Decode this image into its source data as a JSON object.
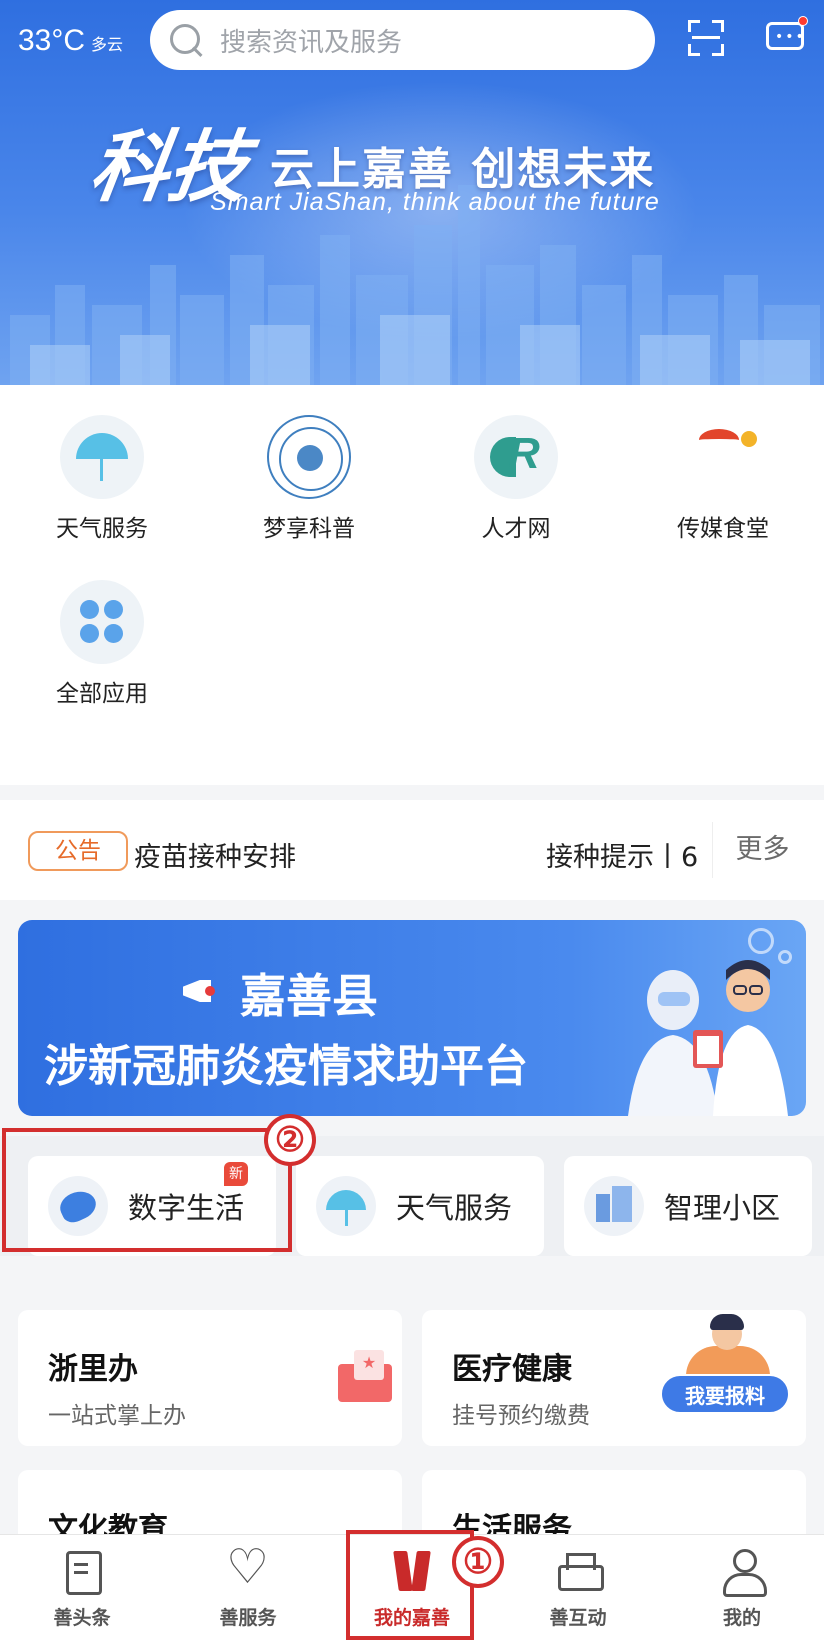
{
  "header": {
    "temperature": "33°C",
    "weather_condition": "多云",
    "search_placeholder": "搜索资讯及服务",
    "scan_icon": "scan-icon",
    "message_icon": "message-icon"
  },
  "banner": {
    "slogan_big": "科技",
    "slogan_main": "云上嘉善  创想未来",
    "slogan_en": "Smart JiaShan, think about the future"
  },
  "apps": [
    {
      "label": "天气服务",
      "icon": "umbrella-icon"
    },
    {
      "label": "梦享科普",
      "icon": "seal-icon"
    },
    {
      "label": "人才网",
      "icon": "talent-logo-icon"
    },
    {
      "label": "传媒食堂",
      "icon": "media-logo-icon"
    },
    {
      "label": "全部应用",
      "icon": "grid-icon"
    }
  ],
  "notice": {
    "tag": "公告",
    "text_left": "疫苗接种安排",
    "text_right": "接种提示丨6",
    "more": "更多"
  },
  "covid_banner": {
    "title": "嘉善县",
    "subtitle": "涉新冠肺炎疫情求助平台"
  },
  "quick_cards": [
    {
      "label": "数字生活",
      "badge": "新",
      "icon": "digital-life-icon"
    },
    {
      "label": "天气服务",
      "icon": "umbrella-icon"
    },
    {
      "label": "智理小区",
      "icon": "community-icon"
    }
  ],
  "annotations": {
    "step1": "①",
    "step2": "②"
  },
  "services": [
    {
      "title": "浙里办",
      "subtitle": "一站式掌上办"
    },
    {
      "title": "医疗健康",
      "subtitle": "挂号预约缴费"
    },
    {
      "title": "文化教育",
      "subtitle": ""
    },
    {
      "title": "生活服务",
      "subtitle": ""
    }
  ],
  "report_button": "我要报料",
  "tabs": [
    {
      "label": "善头条",
      "icon": "news-icon"
    },
    {
      "label": "善服务",
      "icon": "heart-icon"
    },
    {
      "label": "我的嘉善",
      "icon": "jiashan-logo-icon",
      "active": true
    },
    {
      "label": "善互动",
      "icon": "interaction-icon"
    },
    {
      "label": "我的",
      "icon": "user-icon"
    }
  ],
  "colors": {
    "brand_blue": "#2f6fe0",
    "accent_red": "#c92a2a",
    "annotation_red": "#d32e2e",
    "notice_orange": "#e66b2a"
  }
}
